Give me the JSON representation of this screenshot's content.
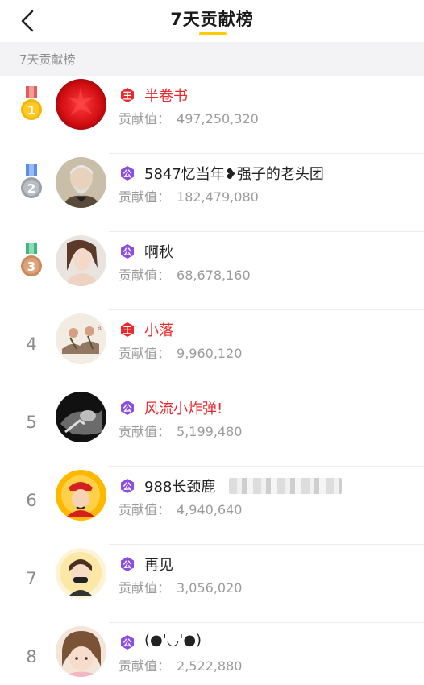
{
  "header": {
    "title": "7天贡献榜",
    "accent_color": "#ffcc00",
    "back_icon": "chevron-left-icon"
  },
  "section": {
    "label": "7天贡献榜"
  },
  "contribution_label": "贡献值：",
  "rows": [
    {
      "rank": "1",
      "medal": "gold",
      "badge": "king",
      "name": "半卷书",
      "name_color": "red",
      "value": "497,250,320"
    },
    {
      "rank": "2",
      "medal": "silver",
      "badge": "duke",
      "name": "5847忆当年❥强子的老头团",
      "name_color": "dark",
      "value": "182,479,080"
    },
    {
      "rank": "3",
      "medal": "bronze",
      "badge": "duke",
      "name": "啊秋",
      "name_color": "dark",
      "value": "68,678,160"
    },
    {
      "rank": "4",
      "medal": "",
      "badge": "king",
      "name": "小落",
      "name_color": "red",
      "value": "9,960,120"
    },
    {
      "rank": "5",
      "medal": "",
      "badge": "duke",
      "name": "风流小炸弹!",
      "name_color": "red",
      "value": "5,199,480"
    },
    {
      "rank": "6",
      "medal": "",
      "badge": "duke",
      "name": "988长颈鹿",
      "name_color": "dark",
      "value": "4,940,640"
    },
    {
      "rank": "7",
      "medal": "",
      "badge": "duke",
      "name": "再见",
      "name_color": "dark",
      "value": "3,056,020"
    },
    {
      "rank": "8",
      "medal": "",
      "badge": "duke",
      "name": "(●'◡'●)",
      "name_color": "dark",
      "value": "2,522,880"
    }
  ],
  "badges": {
    "king": {
      "glyph": "王",
      "color": "#e8292d"
    },
    "duke": {
      "glyph": "公",
      "color": "#8a4fe0"
    }
  }
}
